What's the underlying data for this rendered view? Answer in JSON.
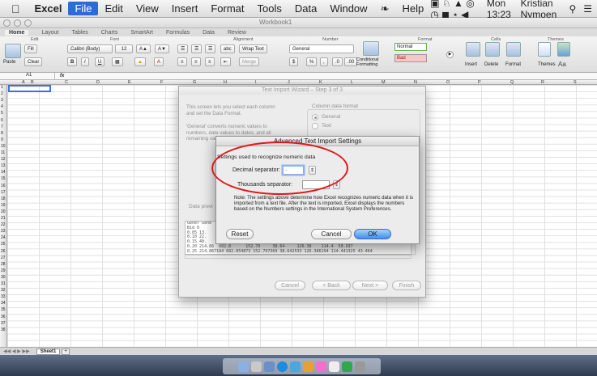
{
  "menubar": {
    "app": "Excel",
    "items": [
      "File",
      "Edit",
      "View",
      "Insert",
      "Format",
      "Tools",
      "Data",
      "Window"
    ],
    "help": "Help",
    "clock": "Mon 13:23",
    "user": "Kristian Nymoen"
  },
  "window": {
    "title": "Workbook1"
  },
  "ribbon": {
    "tabs": [
      "Home",
      "Layout",
      "Tables",
      "Charts",
      "SmartArt",
      "Formulas",
      "Data",
      "Review"
    ],
    "groups": {
      "edit": "Edit",
      "font": "Font",
      "alignment": "Alignment",
      "number": "Number",
      "format": "Format",
      "cells": "Cells",
      "themes": "Themes"
    },
    "paste": "Paste",
    "fill": "Fill",
    "clear": "Clear",
    "font_name": "Calibri (Body)",
    "font_size": "12",
    "wrap_text": "Wrap Text",
    "number_format": "General",
    "merge": "Merge",
    "conditional_formatting": "Conditional Formatting",
    "style_normal": "Normal",
    "style_bad": "Bad",
    "insert": "Insert",
    "delete": "Delete",
    "format": "Format",
    "themes": "Themes"
  },
  "formula_bar": {
    "cell": "A1",
    "fx": "fx"
  },
  "grid": {
    "columns": [
      "A",
      "B",
      "C",
      "D",
      "E",
      "F",
      "G",
      "H",
      "I",
      "J",
      "K",
      "L",
      "M",
      "N",
      "O",
      "P",
      "Q",
      "R",
      "S"
    ],
    "rows": [
      "1",
      "2",
      "3",
      "4",
      "5",
      "6",
      "7",
      "8",
      "9",
      "10",
      "11",
      "12",
      "13",
      "14",
      "15",
      "16",
      "17",
      "18",
      "19",
      "20",
      "21",
      "22",
      "23",
      "24",
      "25",
      "26",
      "27",
      "28",
      "29",
      "30",
      "31",
      "32",
      "33",
      "34",
      "35",
      "36",
      "37",
      "38"
    ]
  },
  "sheet_tab": "Sheet1",
  "wizard": {
    "title": "Text Import Wizard – Step 3 of 3",
    "intro": "This screen lets you select each column and set the Data Format.",
    "general_note": "'General' converts numeric values to numbers, date values to dates, and all remaining values to text.",
    "column_format_label": "Column data format",
    "options": [
      "General",
      "Text"
    ],
    "advanced_partial": "ed",
    "preview_label": "Data previ",
    "preview_rows": [
      "Gener Gene                                                   Genera",
      "Bid 0                                                         ",
      "0.05 13.                                                     104.22",
      "0.10 22.                                                     75.359",
      "0.15 40.                                                     58.886",
      "0.20 214.86  682.8      152.79     38.64     126.38    114.4  50.937",
      "0.25 214.867184 682.854873 152.797369 38.642533 126.386294 114.441325 43.464"
    ],
    "buttons": {
      "cancel": "Cancel",
      "back": "< Back",
      "next": "Next >",
      "finish": "Finish"
    }
  },
  "advanced_dialog": {
    "title": "Advanced Text Import Settings",
    "heading": "Settings used to recognize numeric data",
    "decimal_label": "Decimal separator:",
    "decimal_value": ".",
    "thousands_label": "Thousands separator:",
    "thousands_value": "",
    "note": "Note: The settings above determine how Excel recognizes numeric data when it is imported from a text file. After the text is imported, Excel displays the numbers based on the Numbers settings in the International System Preferences.",
    "reset": "Reset",
    "cancel": "Cancel",
    "ok": "OK"
  },
  "colors": {
    "accent": "#3d8ef0",
    "highlight_ellipse": "#e01818",
    "style_normal_border": "#6ab04c",
    "style_bad_fill": "#f7c6c7"
  }
}
